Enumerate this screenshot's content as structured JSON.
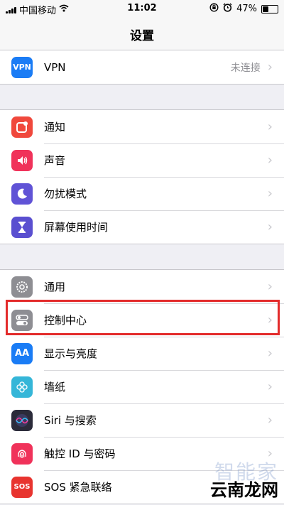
{
  "status_bar": {
    "carrier": "中国移动",
    "time": "11:02",
    "battery": "47%",
    "battery_level": 0.47
  },
  "nav": {
    "title": "设置"
  },
  "groups": [
    {
      "items": [
        {
          "icon": "vpn-icon",
          "icon_text": "VPN",
          "color": "#1a7cf5",
          "label": "VPN",
          "detail": "未连接"
        }
      ]
    },
    {
      "items": [
        {
          "icon": "notifications-icon",
          "color": "#f0483c",
          "label": "通知"
        },
        {
          "icon": "sounds-icon",
          "color": "#f0325a",
          "label": "声音"
        },
        {
          "icon": "moon-icon",
          "color": "#6053d6",
          "label": "勿扰模式"
        },
        {
          "icon": "hourglass-icon",
          "color": "#5a4fd0",
          "label": "屏幕使用时间"
        }
      ]
    },
    {
      "items": [
        {
          "icon": "gear-icon",
          "color": "#8e8e93",
          "label": "通用"
        },
        {
          "icon": "toggle-icon",
          "color": "#8e8e93",
          "label": "控制中心"
        },
        {
          "icon": "display-icon",
          "icon_text": "AA",
          "color": "#1a7cf5",
          "label": "显示与亮度"
        },
        {
          "icon": "wallpaper-icon",
          "color": "#35b6d8",
          "label": "墙纸"
        },
        {
          "icon": "siri-icon",
          "color": "#2b2b3a",
          "label": "Siri 与搜索"
        },
        {
          "icon": "fingerprint-icon",
          "color": "#f0325a",
          "label": "触控 ID 与密码"
        },
        {
          "icon": "sos-icon",
          "icon_text": "SOS",
          "color": "#e8342f",
          "label": "SOS 紧急联络"
        }
      ]
    }
  ],
  "watermark": {
    "text": "云南龙网",
    "faint_text": "智能家"
  }
}
